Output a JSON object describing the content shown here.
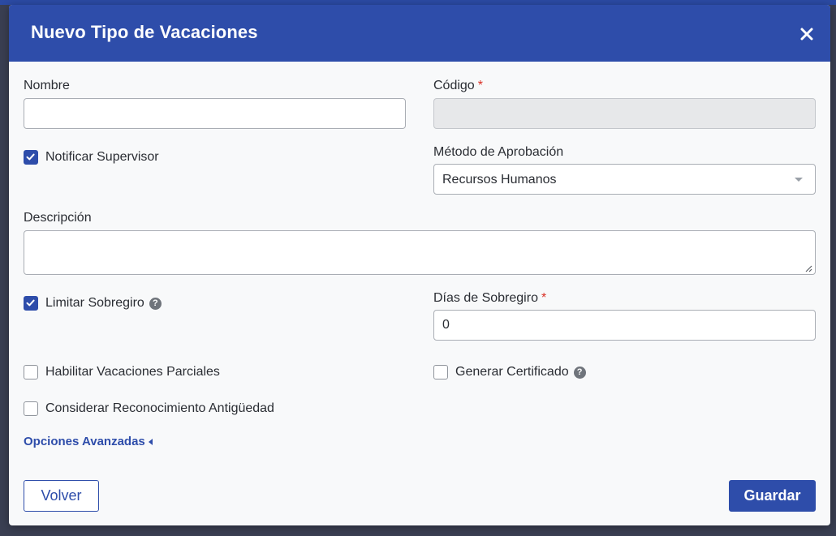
{
  "dialog": {
    "title": "Nuevo Tipo de Vacaciones",
    "close_icon": "close-icon"
  },
  "form": {
    "nombre": {
      "label": "Nombre",
      "value": ""
    },
    "codigo": {
      "label": "Código",
      "required_mark": "*",
      "value": ""
    },
    "notificar_supervisor": {
      "label": "Notificar Supervisor",
      "checked": true
    },
    "metodo_aprobacion": {
      "label": "Método de Aprobación",
      "selected": "Recursos Humanos"
    },
    "descripcion": {
      "label": "Descripción",
      "value": ""
    },
    "limitar_sobregiro": {
      "label": "Limitar Sobregiro",
      "checked": true,
      "help_icon": "?"
    },
    "dias_sobregiro": {
      "label": "Días de Sobregiro",
      "required_mark": "*",
      "value": "0"
    },
    "habilitar_parciales": {
      "label": "Habilitar Vacaciones Parciales",
      "checked": false
    },
    "generar_certificado": {
      "label": "Generar Certificado",
      "checked": false,
      "help_icon": "?"
    },
    "considerar_antiguedad": {
      "label": "Considerar Reconocimiento Antigüedad",
      "checked": false
    }
  },
  "advanced": {
    "label": "Opciones Avanzadas"
  },
  "footer": {
    "back_label": "Volver",
    "save_label": "Guardar"
  },
  "colors": {
    "primary": "#2e4daa",
    "required": "#d93025",
    "backdrop": "#3a3f52"
  }
}
